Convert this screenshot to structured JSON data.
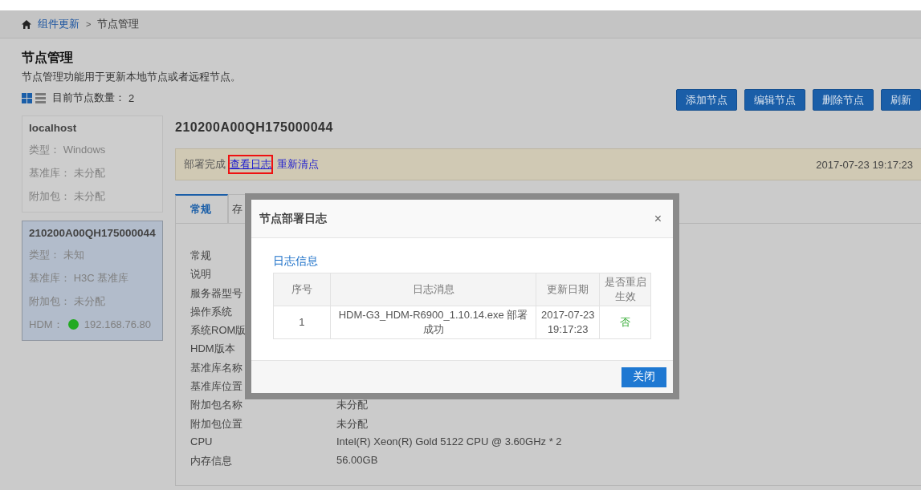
{
  "breadcrumb": {
    "items": [
      {
        "label": "组件更新",
        "link": true
      },
      {
        "label": "节点管理",
        "link": false
      }
    ],
    "separator": ">"
  },
  "page": {
    "title": "节点管理",
    "description": "节点管理功能用于更新本地节点或者远程节点。",
    "view_modes": [
      {
        "kind": "grid",
        "selected": true
      },
      {
        "kind": "list",
        "selected": false
      }
    ],
    "count_label": "目前节点数量：",
    "count": "2"
  },
  "toolbar": [
    "添加节点",
    "编辑节点",
    "删除节点",
    "刷新"
  ],
  "nodes": [
    {
      "name": "localhost",
      "selected": false,
      "fields": [
        {
          "label": "类型：",
          "value": "Windows"
        },
        {
          "label": "基准库：",
          "value": "未分配"
        },
        {
          "label": "附加包：",
          "value": "未分配"
        }
      ]
    },
    {
      "name": "210200A00QH175000044",
      "selected": true,
      "fields": [
        {
          "label": "类型：",
          "value": "未知"
        },
        {
          "label": "基准库：",
          "value": "H3C 基准库"
        },
        {
          "label": "附加包：",
          "value": "未分配"
        },
        {
          "label": "HDM：",
          "value": "192.168.76.80",
          "color": "#22aa22"
        }
      ]
    }
  ],
  "detail": {
    "title": "210200A00QH175000044",
    "status": {
      "text": "部署完成",
      "links": [
        {
          "label": "查看日志",
          "highlighted": true
        },
        {
          "label": "重新清点",
          "highlighted": false
        }
      ],
      "time": "2017-07-23 19:17:23"
    },
    "tabs": [
      {
        "label": "常规",
        "selected": true
      },
      {
        "label": "存",
        "selected": false
      }
    ],
    "properties": [
      {
        "label": "常规"
      },
      {
        "label": "说明"
      },
      {
        "label": "服务器型号"
      },
      {
        "label": "操作系统"
      },
      {
        "label": "系统ROM版"
      },
      {
        "label": "HDM版本"
      },
      {
        "label": "基准库名称"
      },
      {
        "label": "基准库位置"
      },
      {
        "label": "附加包名称",
        "value": "未分配"
      },
      {
        "label": "附加包位置",
        "value": "未分配"
      },
      {
        "label": "CPU",
        "value": "Intel(R) Xeon(R) Gold 5122 CPU @ 3.60GHz * 2"
      },
      {
        "label": "内存信息",
        "value": "56.00GB"
      }
    ]
  },
  "dialog": {
    "title": "节点部署日志",
    "close": "×",
    "section": "日志信息",
    "columns": [
      "序号",
      "日志消息",
      "更新日期",
      "是否重启生效"
    ],
    "rows": [
      {
        "index": "1",
        "message": "HDM-G3_HDM-R6900_1.10.14.exe 部署成功",
        "date": "2017-07-23 19:17:23",
        "restart": "否"
      }
    ],
    "button": "关闭"
  }
}
